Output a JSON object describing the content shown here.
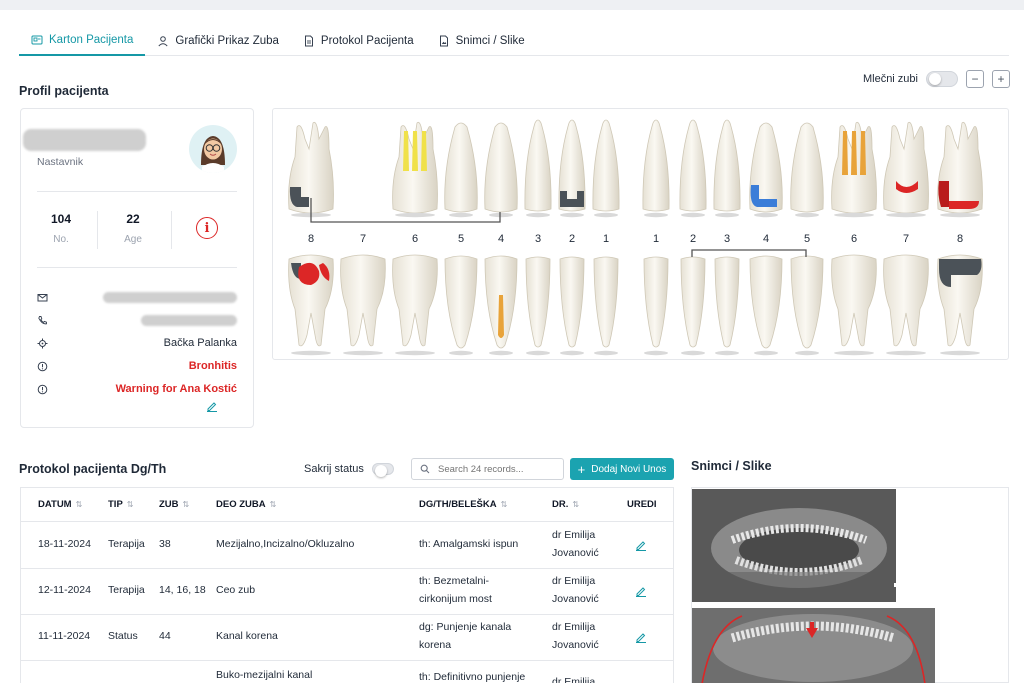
{
  "tabs": [
    {
      "label": "Karton Pacijenta",
      "icon": "id-card-icon",
      "active": true
    },
    {
      "label": "Grafički Prikaz Zuba",
      "icon": "user-icon",
      "active": false
    },
    {
      "label": "Protokol Pacijenta",
      "icon": "document-icon",
      "active": false
    },
    {
      "label": "Snimci / Slike",
      "icon": "image-document-icon",
      "active": false
    }
  ],
  "profile": {
    "section_title": "Profil pacijenta",
    "role": "Nastavnik",
    "stats": [
      {
        "value": "104",
        "label": "No."
      },
      {
        "value": "22",
        "label": "Age"
      }
    ],
    "alert_icon": "info-icon",
    "city": "Bačka Palanka",
    "condition": "Bronhitis",
    "warning": "Warning for Ana Kostić"
  },
  "chart": {
    "milk_teeth_label": "Mlečni zubi",
    "minus": "−",
    "plus": "+",
    "upper_numbers": [
      "8",
      "7",
      "6",
      "5",
      "4",
      "3",
      "2",
      "1",
      "1",
      "2",
      "3",
      "4",
      "5",
      "6",
      "7",
      "8"
    ],
    "colors": {
      "amalgam": "#4b5258",
      "canal": "#f0e14a",
      "canal_orange": "#e8a33a",
      "red": "#dc2626",
      "blue": "#3b7dd8"
    }
  },
  "protocol": {
    "title": "Protokol pacijenta Dg/Th",
    "hide_status_label": "Sakrij status",
    "search_placeholder": "Search 24 records...",
    "add_button": "Dodaj Novi Unos",
    "columns": [
      "DATUM",
      "TIP",
      "ZUB",
      "DEO ZUBA",
      "DG/TH/BELEŠKA",
      "DR.",
      "UREDI"
    ],
    "rows": [
      {
        "datum": "18-11-2024",
        "tip": "Terapija",
        "zub": "38",
        "deo": "Mezijalno,Incizalno/Okluzalno",
        "dg1": "th: Amalgamski ispun",
        "dg2": "",
        "dr1": "dr Emilija",
        "dr2": "Jovanović"
      },
      {
        "datum": "12-11-2024",
        "tip": "Terapija",
        "zub": "14, 16, 18",
        "deo": "Ceo zub",
        "dg1": "th: Bezmetalni-",
        "dg2": "cirkonijum most",
        "dr1": "dr Emilija",
        "dr2": "Jovanović"
      },
      {
        "datum": "11-11-2024",
        "tip": "Status",
        "zub": "44",
        "deo": "Kanal korena",
        "dg1": "dg: Punjenje kanala",
        "dg2": "korena",
        "dr1": "dr Emilija",
        "dr2": "Jovanović"
      },
      {
        "datum": "",
        "tip": "",
        "zub": "",
        "deo": "Buko-mezijalni kanal",
        "dg1": "th: Definitivno punjenje",
        "dg2": "",
        "dr1": "dr Emilija",
        "dr2": ""
      }
    ]
  },
  "images": {
    "title": "Snimci / Slike"
  }
}
